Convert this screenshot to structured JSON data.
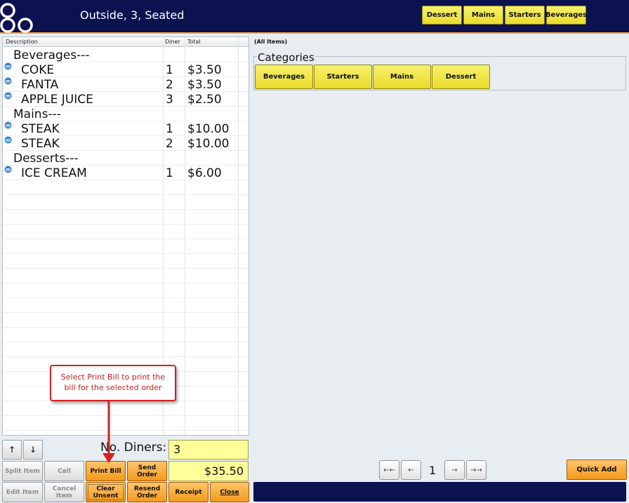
{
  "header": {
    "title": "Outside, 3, Seated",
    "top_categories": [
      "Dessert",
      "Mains",
      "Starters",
      "Beverages"
    ]
  },
  "order": {
    "columns": [
      "Description",
      "Diner",
      "Total"
    ],
    "rows": [
      {
        "type": "group",
        "desc": "Beverages---",
        "diner": "",
        "total": ""
      },
      {
        "type": "item",
        "desc": "COKE",
        "diner": "1",
        "total": "$3.50"
      },
      {
        "type": "item",
        "desc": "FANTA",
        "diner": "2",
        "total": "$3.50"
      },
      {
        "type": "item",
        "desc": "APPLE JUICE",
        "diner": "3",
        "total": "$2.50"
      },
      {
        "type": "group",
        "desc": "Mains---",
        "diner": "",
        "total": ""
      },
      {
        "type": "item",
        "desc": "STEAK",
        "diner": "1",
        "total": "$10.00"
      },
      {
        "type": "item",
        "desc": "STEAK",
        "diner": "2",
        "total": "$10.00"
      },
      {
        "type": "group",
        "desc": "Desserts---",
        "diner": "",
        "total": ""
      },
      {
        "type": "item",
        "desc": "ICE CREAM",
        "diner": "1",
        "total": "$6.00"
      }
    ]
  },
  "controls": {
    "diners_label": "No. Diners:",
    "diners_value": "3",
    "order_total": "$35.50",
    "buttons": {
      "split_item": "Split Item",
      "call": "Call",
      "print_bill": "Print  Bill",
      "send_order": "Send Order",
      "edit_item": "Edit Item",
      "cancel_item": "Cancel Item",
      "clear_unsent": "Clear Unsent",
      "resend_order": "Resend Order",
      "receipt": "Receipt",
      "close": "Close"
    }
  },
  "menu": {
    "filter_label": "(All Items)",
    "categories_title": "Categories",
    "categories": [
      "Beverages",
      "Starters",
      "Mains",
      "Dessert"
    ],
    "page": "1",
    "quick_add": "Quick Add"
  },
  "callout": {
    "text": "Select Print Bill to print the bill for the selected order"
  },
  "icons": {
    "logo": "brand-logo",
    "row_marker": "sent-item-icon",
    "up": "arrow-up-icon",
    "down": "arrow-down-icon",
    "first": "first-page-icon",
    "prev": "prev-page-icon",
    "next": "next-page-icon",
    "last": "last-page-icon"
  },
  "colors": {
    "topbar": "#0c1150",
    "yellow_button": "#f0e440",
    "orange_button": "#f5a42a",
    "field_yellow": "#ffff99",
    "callout_red": "#d42020"
  }
}
